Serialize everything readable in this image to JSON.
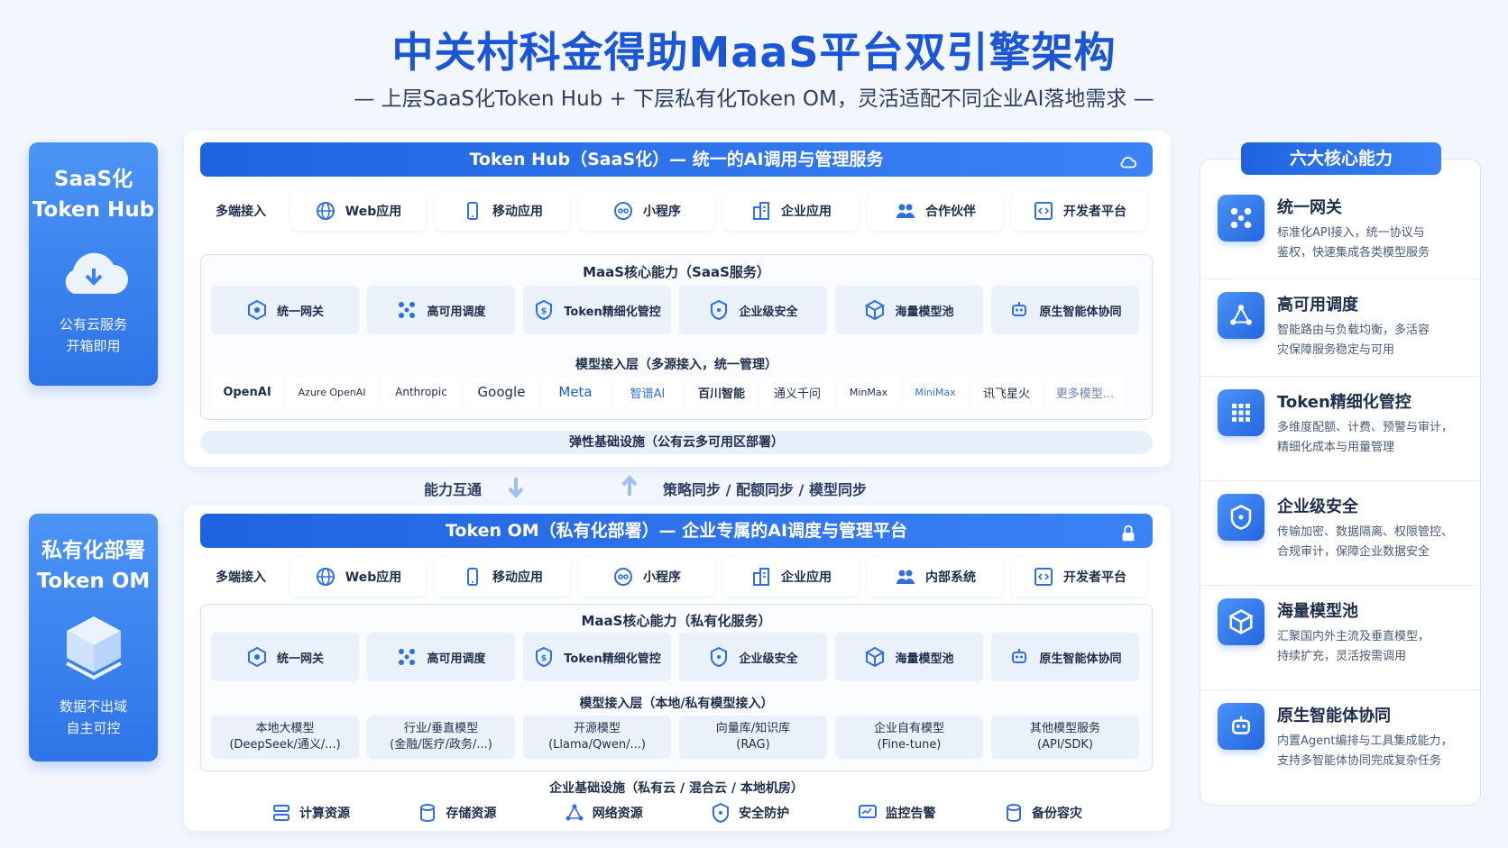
{
  "header": {
    "title": "中关村科金得助MaaS平台双引擎架构",
    "subtitle": "— 上层SaaS化Token Hub + 下层私有化Token OM，灵活适配不同企业AI落地需求 —"
  },
  "left_top": {
    "line1": "SaaS化",
    "line2": "Token Hub",
    "desc1": "公有云服务",
    "desc2": "开箱即用"
  },
  "left_bottom": {
    "line1": "私有化部署",
    "line2": "Token OM",
    "desc1": "数据不出域",
    "desc2": "自主可控"
  },
  "hub": {
    "bar_title": "Token Hub（SaaS化）— 统一的AI调用与管理服务",
    "access_label": "多端接入",
    "access": [
      "Web应用",
      "移动应用",
      "小程序",
      "企业应用",
      "合作伙伴",
      "开发者平台"
    ],
    "core_title": "MaaS核心能力（SaaS服务）",
    "caps": [
      "统一网关",
      "高可用调度",
      "Token精细化管控",
      "企业级安全",
      "海量模型池",
      "原生智能体协同"
    ],
    "model_layer": "模型接入层（多源接入，统一管理）",
    "vendors": [
      "OpenAI",
      "Azure OpenAI",
      "Anthropic",
      "Google",
      "Meta",
      "智谱AI",
      "百川智能",
      "通义千问",
      "MinMax",
      "MiniMax",
      "讯飞星火",
      "更多模型..."
    ],
    "infra": "弹性基础设施（公有云多可用区部署）"
  },
  "middle": {
    "left": "能力互通",
    "right": "策略同步 / 配额同步 / 模型同步"
  },
  "om": {
    "bar_title": "Token OM（私有化部署）— 企业专属的AI调度与管理平台",
    "access_label": "多端接入",
    "access": [
      "Web应用",
      "移动应用",
      "小程序",
      "企业应用",
      "内部系统",
      "开发者平台"
    ],
    "core_title": "MaaS核心能力（私有化服务）",
    "caps": [
      "统一网关",
      "高可用调度",
      "Token精细化管控",
      "企业级安全",
      "海量模型池",
      "原生智能体协同"
    ],
    "model_layer": "模型接入层（本地/私有模型接入）",
    "models": [
      {
        "name": "本地大模型",
        "detail": "(DeepSeek/通义/...)"
      },
      {
        "name": "行业/垂直模型",
        "detail": "(金融/医疗/政务/...)"
      },
      {
        "name": "开源模型",
        "detail": "(Llama/Qwen/...)"
      },
      {
        "name": "向量库/知识库",
        "detail": "(RAG)"
      },
      {
        "name": "企业自有模型",
        "detail": "(Fine-tune)"
      },
      {
        "name": "其他模型服务",
        "detail": "(API/SDK)"
      }
    ],
    "infra": "企业基础设施（私有云 / 混合云 / 本地机房）",
    "resources": [
      "计算资源",
      "存储资源",
      "网络资源",
      "安全防护",
      "监控告警",
      "备份容灾"
    ]
  },
  "right_panel": {
    "title": "六大核心能力",
    "features": [
      {
        "name": "统一网关",
        "desc1": "标准化API接入，统一协议与",
        "desc2": "鉴权，快速集成各类模型服务"
      },
      {
        "name": "高可用调度",
        "desc1": "智能路由与负载均衡，多活容",
        "desc2": "灾保障服务稳定与可用"
      },
      {
        "name": "Token精细化管控",
        "desc1": "多维度配额、计费、预警与审计，",
        "desc2": "精细化成本与用量管理"
      },
      {
        "name": "企业级安全",
        "desc1": "传输加密、数据隔离、权限管控、",
        "desc2": "合规审计，保障企业数据安全"
      },
      {
        "name": "海量模型池",
        "desc1": "汇聚国内外主流及垂直模型，",
        "desc2": "持续扩充，灵活按需调用"
      },
      {
        "name": "原生智能体协同",
        "desc1": "内置Agent编排与工具集成能力，",
        "desc2": "支持多智能体协同完成复杂任务"
      }
    ]
  },
  "colors": {
    "accent": "#1a56d6",
    "bar": "#2f6fe3",
    "panel_bg": "#eaf1fb"
  }
}
